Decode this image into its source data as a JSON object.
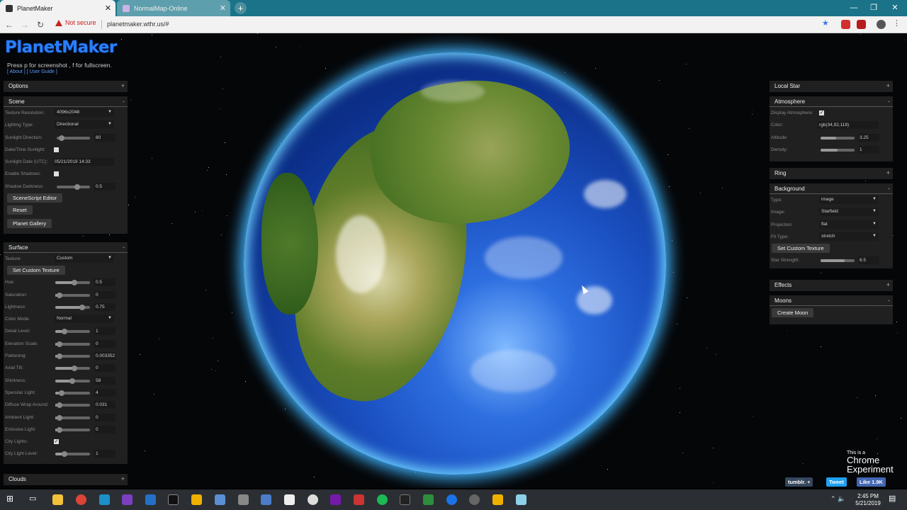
{
  "browser": {
    "tabs": [
      {
        "title": "PlanetMaker",
        "active": true
      },
      {
        "title": "NormalMap-Online",
        "active": false
      }
    ],
    "security": "Not secure",
    "url": "planetmaker.wthr.us/#"
  },
  "page": {
    "logo": "PlanetMaker",
    "hint": "Press p for screenshot , f for fullscreen.",
    "about": "[ About ]",
    "guide": "[ User Guide ]"
  },
  "left_panel": {
    "options": "Options",
    "scene": {
      "title": "Scene",
      "texture_resolution_label": "Texture Resolution:",
      "texture_resolution": "4096x2048",
      "lighting_type_label": "Lighting Type:",
      "lighting_type": "Directional",
      "sunlight_direction_label": "Sunlight Direction:",
      "sunlight_direction": "80",
      "datetime_sunlight_label": "Date/Time Sunlight:",
      "sunlight_date_label": "Sunlight Date (UTC):",
      "sunlight_date": "05/21/2019 14:33",
      "enable_shadows_label": "Enable Shadows:",
      "shadow_darkness_label": "Shadow Darkness:",
      "shadow_darkness": "0.5",
      "scenescript_button": "SceneScript Editor",
      "reset_button": "Reset",
      "gallery_button": "Planet Gallery"
    },
    "surface": {
      "title": "Surface",
      "texture_label": "Texture:",
      "texture": "Custom",
      "set_texture_button": "Set Custom Texture",
      "sliders": [
        {
          "label": "Hue:",
          "value": "0.5",
          "level": 0.5
        },
        {
          "label": "Saturation:",
          "value": "0",
          "level": 0.05
        },
        {
          "label": "Lightness:",
          "value": "0.75",
          "level": 0.75
        },
        {
          "label": "Color Mode:",
          "value": "Normal",
          "select": true
        },
        {
          "label": "Detail Level:",
          "value": "1",
          "level": 0.2
        },
        {
          "label": "Elevation Scale:",
          "value": "0",
          "level": 0.05
        },
        {
          "label": "Flattening:",
          "value": "0.003352",
          "level": 0.05
        },
        {
          "label": "Axial Tilt:",
          "value": "0",
          "level": 0.5
        },
        {
          "label": "Shininess:",
          "value": "58",
          "level": 0.45
        },
        {
          "label": "Specular Light:",
          "value": "4",
          "level": 0.1
        },
        {
          "label": "Diffuse Wrap Around:",
          "value": "0.031",
          "level": 0.05
        },
        {
          "label": "Ambient Light:",
          "value": "0",
          "level": 0.05
        },
        {
          "label": "Emissive Light:",
          "value": "0",
          "level": 0.05
        },
        {
          "label": "City Lights:",
          "checkbox": true
        },
        {
          "label": "City Light Level:",
          "value": "1",
          "level": 0.2
        }
      ]
    },
    "clouds": "Clouds"
  },
  "right_panel": {
    "local_star": "Local Star",
    "atmosphere": {
      "title": "Atmosphere",
      "display_label": "Display Atmosphere:",
      "color_label": "Color:",
      "color": "rgb(34,92,118)",
      "altitude_label": "Altitude:",
      "altitude": "3.25",
      "altitude_level": 0.45,
      "density_label": "Density:",
      "density": "1",
      "density_level": 0.5
    },
    "ring": "Ring",
    "background": {
      "title": "Background",
      "type_label": "Type:",
      "type": "image",
      "image_label": "Image:",
      "image": "Starfield",
      "projection_label": "Projection:",
      "projection": "flat",
      "fit_label": "Fit Type:",
      "fit": "stretch",
      "set_texture_button": "Set Custom Texture",
      "star_strength_label": "Star Strength:",
      "star_strength": "6.5",
      "star_strength_level": 0.7
    },
    "effects": "Effects",
    "moons": {
      "title": "Moons",
      "create_button": "Create Moon"
    }
  },
  "badge": {
    "line1": "This is a",
    "line2": "Chrome",
    "line3": "Experiment",
    "tumblr": "tumblr. +",
    "tweet": "Tweet",
    "like": "Like 1.9K"
  },
  "taskbar": {
    "time": "2:45 PM",
    "date": "5/21/2019"
  }
}
